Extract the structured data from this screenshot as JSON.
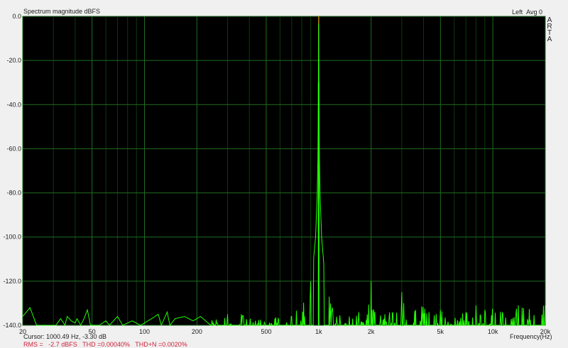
{
  "header": {
    "title": "Spectrum magnitude dBFS",
    "channel": "Left",
    "avg": "Avg 0",
    "logo": [
      "A",
      "R",
      "T",
      "A"
    ]
  },
  "footer": {
    "cursor": "Cursor: 1000.49 Hz, -3.30 dB",
    "measurement": "RMS =   -2.7 dBFS   THD =0.00040%   THD+N =0.0020%"
  },
  "colors": {
    "trace": "#22ff00",
    "cursor": "#b8860b",
    "grid_major": "#1e6e1e",
    "grid_minor": "#0b3a0b",
    "background": "#000000"
  },
  "chart_data": {
    "type": "line",
    "title": "Spectrum magnitude dBFS",
    "xlabel": "Frequency(Hz)",
    "ylabel": "dBFS",
    "xscale": "log",
    "xlim": [
      20,
      20000
    ],
    "ylim": [
      -140,
      0
    ],
    "grid": true,
    "xticks": [
      {
        "v": 20,
        "l": "20"
      },
      {
        "v": 50,
        "l": "50"
      },
      {
        "v": 100,
        "l": "100"
      },
      {
        "v": 200,
        "l": "200"
      },
      {
        "v": 500,
        "l": "500"
      },
      {
        "v": 1000,
        "l": "1k"
      },
      {
        "v": 2000,
        "l": "2k"
      },
      {
        "v": 5000,
        "l": "5k"
      },
      {
        "v": 10000,
        "l": "10k"
      },
      {
        "v": 20000,
        "l": "20k"
      }
    ],
    "yticks": [
      {
        "v": 0,
        "l": "0.0"
      },
      {
        "v": -20,
        "l": "-20.0"
      },
      {
        "v": -40,
        "l": "-40.0"
      },
      {
        "v": -60,
        "l": "-60.0"
      },
      {
        "v": -80,
        "l": "-80.0"
      },
      {
        "v": -100,
        "l": "-100.0"
      },
      {
        "v": -120,
        "l": "-120.0"
      },
      {
        "v": -140,
        "l": "-140.0"
      }
    ],
    "cursor": {
      "freq": 1000.49,
      "db": -3.3
    },
    "series": [
      {
        "name": "Left",
        "points": [
          [
            20,
            -136
          ],
          [
            21,
            -134
          ],
          [
            22,
            -132
          ],
          [
            23,
            -136
          ],
          [
            24,
            -140
          ],
          [
            26,
            -140
          ],
          [
            28,
            -140
          ],
          [
            31,
            -140
          ],
          [
            33,
            -137
          ],
          [
            35,
            -140
          ],
          [
            36,
            -136
          ],
          [
            38,
            -138
          ],
          [
            40,
            -139
          ],
          [
            41,
            -137
          ],
          [
            43,
            -140
          ],
          [
            45,
            -137
          ],
          [
            47,
            -133
          ],
          [
            49,
            -140
          ],
          [
            55,
            -140
          ],
          [
            60,
            -138
          ],
          [
            63,
            -140
          ],
          [
            70,
            -136
          ],
          [
            75,
            -140
          ],
          [
            85,
            -138
          ],
          [
            95,
            -140
          ],
          [
            110,
            -137
          ],
          [
            120,
            -135
          ],
          [
            125,
            -140
          ],
          [
            135,
            -134
          ],
          [
            140,
            -140
          ],
          [
            150,
            -137
          ],
          [
            170,
            -136
          ],
          [
            190,
            -138
          ],
          [
            210,
            -136
          ],
          [
            240,
            -140
          ],
          [
            250,
            -134
          ],
          [
            270,
            -137
          ],
          [
            300,
            -135
          ],
          [
            330,
            -138
          ],
          [
            360,
            -135
          ],
          [
            400,
            -137
          ],
          [
            450,
            -136
          ],
          [
            500,
            -138
          ],
          [
            550,
            -135
          ],
          [
            600,
            -137
          ],
          [
            650,
            -134
          ],
          [
            700,
            -136
          ],
          [
            750,
            -133
          ],
          [
            800,
            -130
          ],
          [
            850,
            -126
          ],
          [
            900,
            -120
          ],
          [
            930,
            -112
          ],
          [
            960,
            -100
          ],
          [
            980,
            -82
          ],
          [
            990,
            -65
          ],
          [
            995,
            -40
          ],
          [
            1000,
            -3.3
          ],
          [
            1005,
            -40
          ],
          [
            1010,
            -65
          ],
          [
            1020,
            -82
          ],
          [
            1040,
            -100
          ],
          [
            1070,
            -112
          ],
          [
            1100,
            -120
          ],
          [
            1150,
            -127
          ],
          [
            1200,
            -132
          ],
          [
            1300,
            -135
          ],
          [
            1400,
            -133
          ],
          [
            1500,
            -136
          ],
          [
            1700,
            -134
          ],
          [
            1900,
            -135
          ],
          [
            2000,
            -120
          ],
          [
            2100,
            -134
          ],
          [
            2400,
            -135
          ],
          [
            2700,
            -133
          ],
          [
            3000,
            -125
          ],
          [
            3200,
            -134
          ],
          [
            3600,
            -133
          ],
          [
            4000,
            -128
          ],
          [
            4300,
            -134
          ],
          [
            5000,
            -133
          ],
          [
            6000,
            -132
          ],
          [
            7000,
            -134
          ],
          [
            8000,
            -131
          ],
          [
            9000,
            -133
          ],
          [
            10000,
            -132
          ],
          [
            12000,
            -133
          ],
          [
            14000,
            -131
          ],
          [
            16000,
            -132
          ],
          [
            18000,
            -130
          ],
          [
            20000,
            -131
          ]
        ]
      }
    ]
  }
}
